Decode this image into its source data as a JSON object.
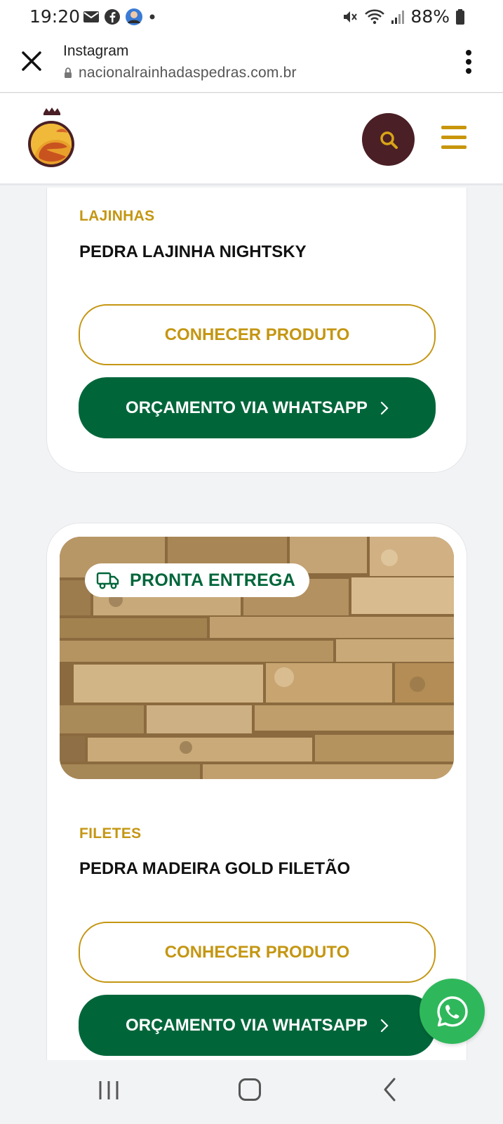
{
  "status_bar": {
    "time": "19:20",
    "battery": "88%",
    "icons": [
      "mail-icon",
      "facebook-icon",
      "avatar",
      "dot-icon",
      "mute-icon",
      "wifi-icon",
      "signal-icon",
      "battery-icon"
    ]
  },
  "browser": {
    "title": "Instagram",
    "url": "nacionalrainhadaspedras.com.br"
  },
  "header": {
    "logo": "logo",
    "search_icon": "search-icon",
    "menu_icon": "hamburger-menu-icon"
  },
  "products": [
    {
      "category": "LAJINHAS",
      "name": "PEDRA LAJINHA NIGHTSKY",
      "primary_button": "CONHECER PRODUTO",
      "whatsapp_button": "ORÇAMENTO VIA WHATSAPP"
    },
    {
      "badge": "PRONTA ENTREGA",
      "category": "FILETES",
      "name": "PEDRA MADEIRA GOLD FILETÃO",
      "primary_button": "CONHECER PRODUTO",
      "whatsapp_button": "ORÇAMENTO VIA WHATSAPP"
    }
  ],
  "floating": {
    "icon": "whatsapp-icon"
  },
  "colors": {
    "gold": "#c49612",
    "green": "#00663a",
    "maroon": "#4a1f25",
    "whatsapp": "#2fb85b"
  }
}
